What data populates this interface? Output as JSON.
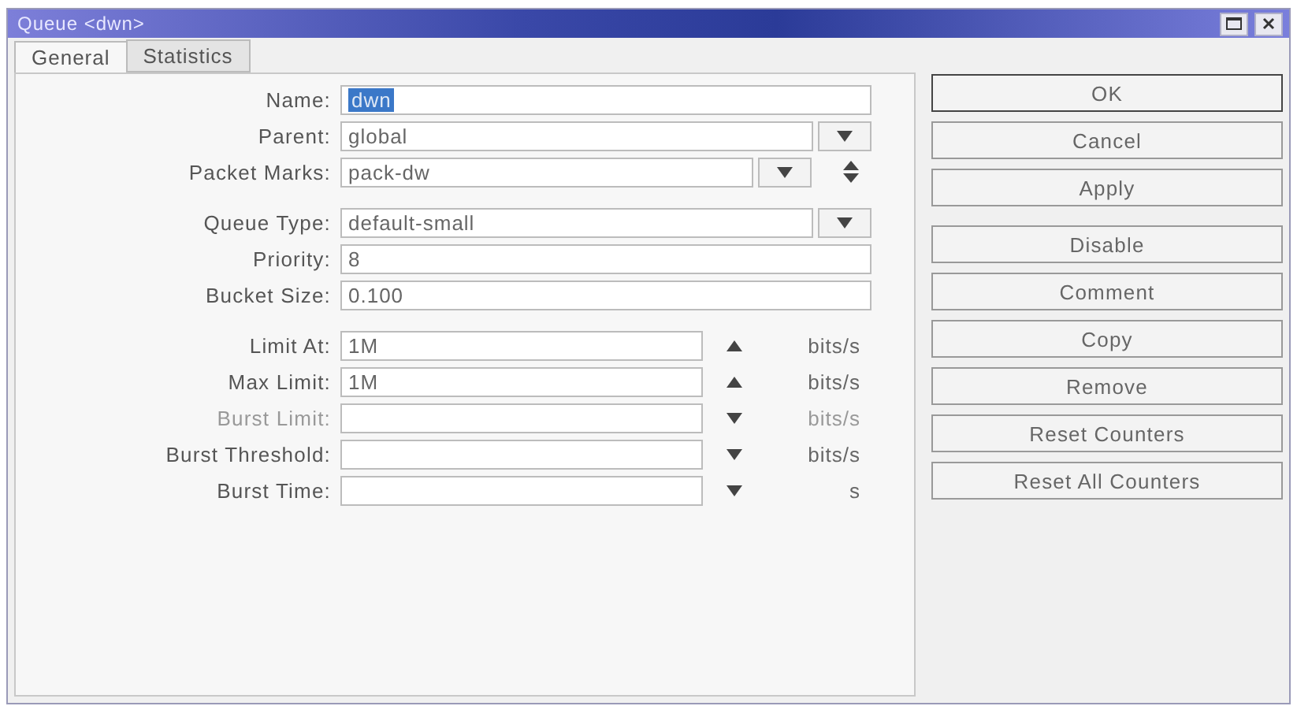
{
  "window": {
    "title": "Queue <dwn>"
  },
  "tabs": [
    {
      "label": "General",
      "selected": true
    },
    {
      "label": "Statistics",
      "selected": false
    }
  ],
  "sections": [
    {
      "rows": [
        {
          "label": "Name:",
          "kind": "text",
          "value": "dwn",
          "selected": true
        },
        {
          "label": "Parent:",
          "kind": "dropdown",
          "value": "global"
        },
        {
          "label": "Packet Marks:",
          "kind": "multi",
          "value": "pack-dw"
        }
      ]
    },
    {
      "rows": [
        {
          "label": "Queue Type:",
          "kind": "dropdown",
          "value": "default-small"
        },
        {
          "label": "Priority:",
          "kind": "text",
          "value": "8"
        },
        {
          "label": "Bucket Size:",
          "kind": "text",
          "value": "0.100"
        }
      ]
    },
    {
      "rows": [
        {
          "label": "Limit At:",
          "kind": "rate",
          "value": "1M",
          "expanded": true,
          "disabled": false,
          "unit": "bits/s"
        },
        {
          "label": "Max Limit:",
          "kind": "rate",
          "value": "1M",
          "expanded": true,
          "disabled": false,
          "unit": "bits/s"
        },
        {
          "label": "Burst Limit:",
          "kind": "rate",
          "expanded": false,
          "disabled": true,
          "unit": "bits/s"
        },
        {
          "label": "Burst Threshold:",
          "kind": "rate",
          "expanded": false,
          "disabled": false,
          "unit": "bits/s"
        },
        {
          "label": "Burst Time:",
          "kind": "rate",
          "expanded": false,
          "disabled": false,
          "unit": "s"
        }
      ]
    }
  ],
  "button_groups": [
    [
      {
        "label": "OK",
        "default": true
      },
      {
        "label": "Cancel",
        "default": false
      },
      {
        "label": "Apply",
        "default": false
      }
    ],
    [
      {
        "label": "Disable",
        "default": false
      },
      {
        "label": "Comment",
        "default": false
      },
      {
        "label": "Copy",
        "default": false
      },
      {
        "label": "Remove",
        "default": false
      },
      {
        "label": "Reset Counters",
        "default": false
      },
      {
        "label": "Reset All Counters",
        "default": false
      }
    ]
  ]
}
